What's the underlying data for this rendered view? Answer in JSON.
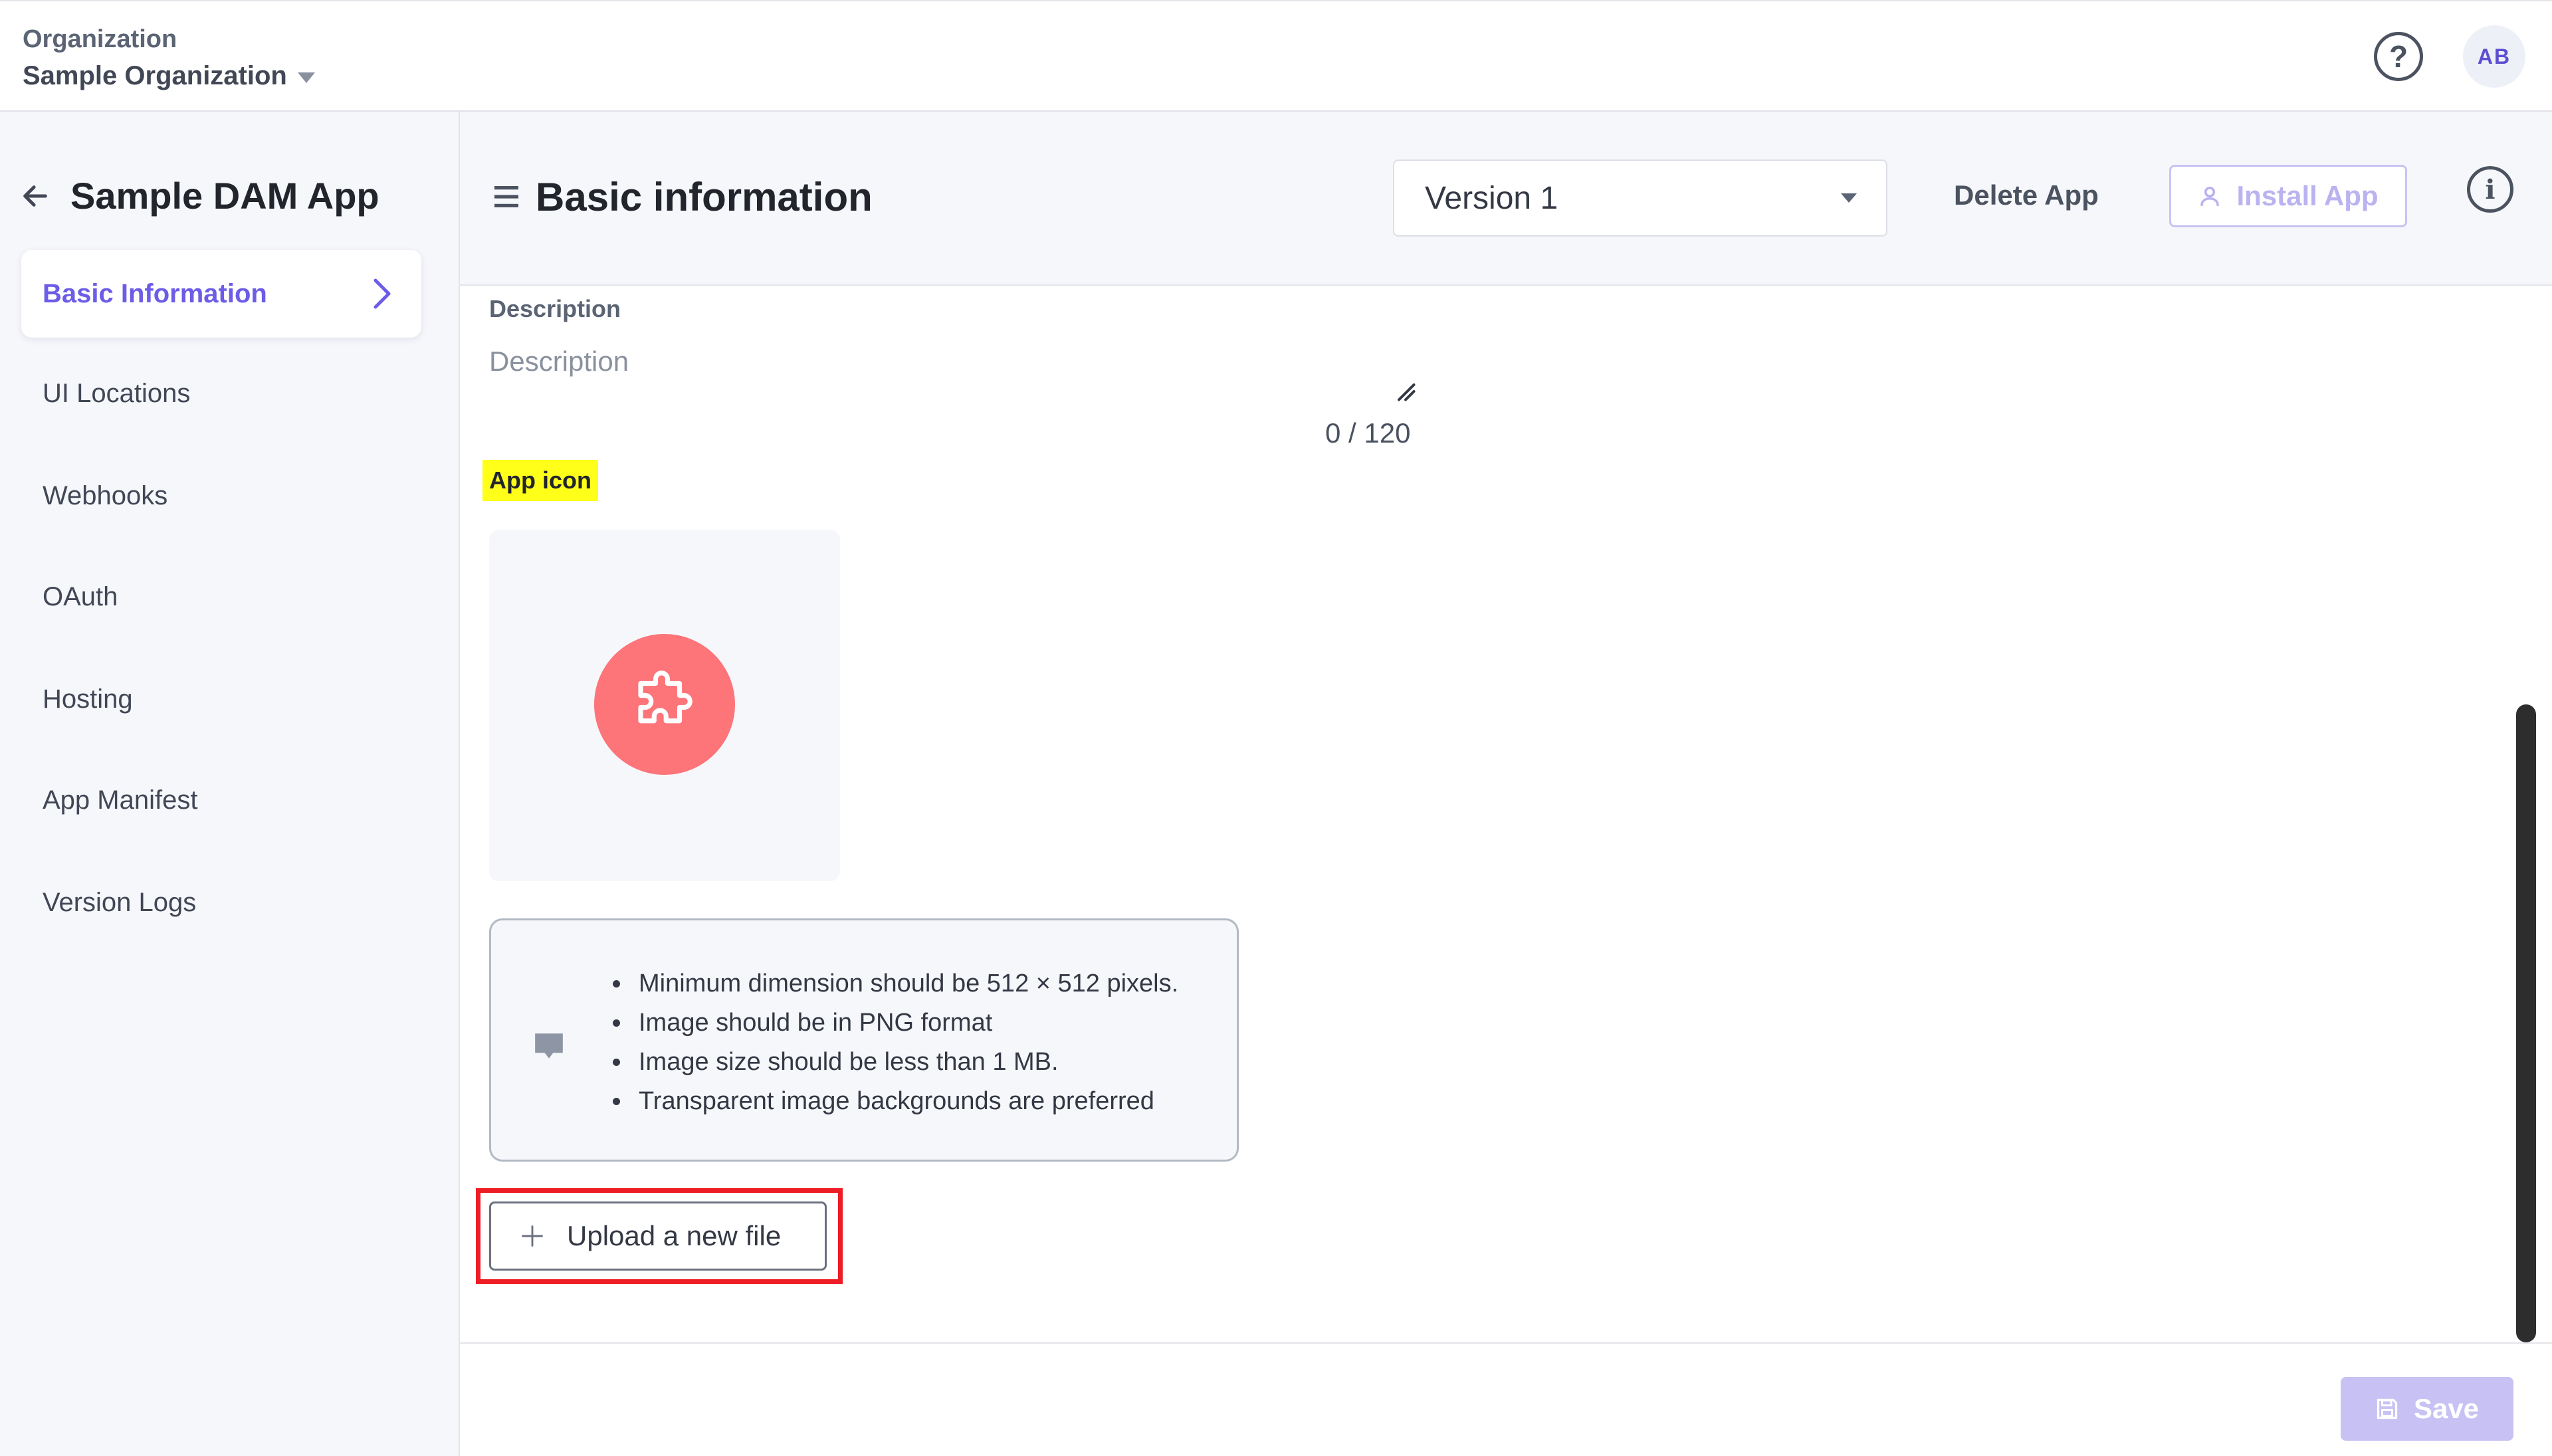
{
  "topbar": {
    "org_label": "Organization",
    "org_name": "Sample Organization",
    "help_icon": "question-circle-icon",
    "avatar_initials": "AB"
  },
  "sidebar": {
    "app_title": "Sample DAM App",
    "back_icon": "arrow-left-icon",
    "active_item": "Basic Information",
    "items": [
      {
        "label": "Basic Information"
      },
      {
        "label": "UI Locations"
      },
      {
        "label": "Webhooks"
      },
      {
        "label": "OAuth"
      },
      {
        "label": "Hosting"
      },
      {
        "label": "App Manifest"
      },
      {
        "label": "Version Logs"
      }
    ]
  },
  "header": {
    "title": "Basic information",
    "version_selected": "Version 1",
    "delete_label": "Delete App",
    "install_label": "Install App",
    "info_icon": "info-circle-icon"
  },
  "form": {
    "description_label": "Description",
    "description_placeholder": "Description",
    "char_count": "0 / 120",
    "app_icon_label": "App icon",
    "app_icon_default": "puzzle-piece-icon",
    "requirements": [
      "Minimum dimension should be 512 × 512 pixels.",
      "Image should be in PNG format",
      "Image size should be less than 1 MB.",
      "Transparent image backgrounds are preferred"
    ],
    "upload_label": "Upload a new file"
  },
  "footer": {
    "save_label": "Save"
  },
  "colors": {
    "accent": "#6c5ce7",
    "accent_disabled": "#c7c2f3",
    "icon_bg": "#fd7479",
    "highlight_yellow": "#ffff1a",
    "annotation_red": "#ee1c25",
    "sidebar_bg": "#f6f7fb"
  }
}
